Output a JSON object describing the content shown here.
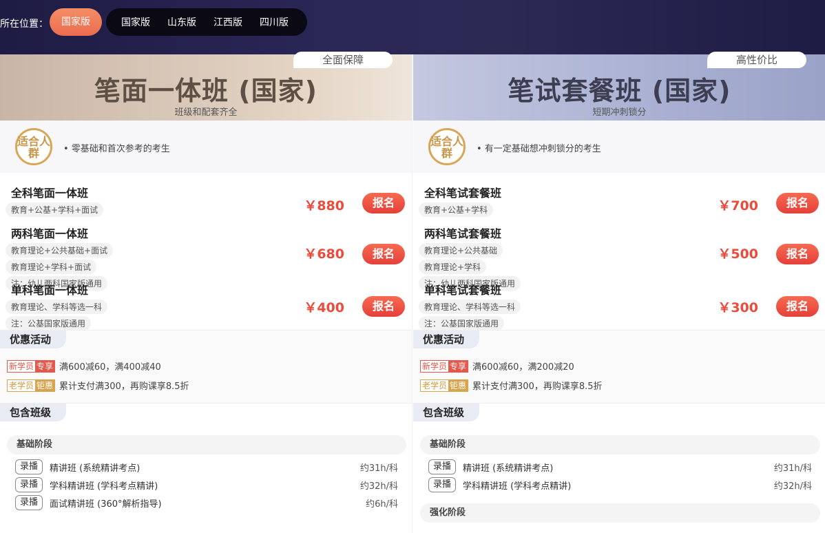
{
  "location": {
    "label": "所在位置：",
    "current": "国家版",
    "options": [
      "国家版",
      "山东版",
      "江西版",
      "四川版"
    ]
  },
  "colors": {
    "accent": "#ea6c4e",
    "price": "#ec4a3a",
    "gold": "#d9a657"
  },
  "columns": [
    {
      "tag": "全面保障",
      "title": "笔面一体班 (国家)",
      "subtitle": "班级和配套齐全",
      "badge": "适合人群",
      "target": "• 零基础和首次参考的考生",
      "products": [
        {
          "name": "全科笔面一体班",
          "chips": [
            "教育+公基+学科+面试"
          ],
          "price": "￥880",
          "button": "报名"
        },
        {
          "name": "两科笔面一体班",
          "chips": [
            "教育理论+公共基础+面试",
            "教育理论+学科+面试",
            "注：幼儿两科国家版通用"
          ],
          "price": "￥680",
          "button": "报名"
        },
        {
          "name": "单科笔面一体班",
          "chips": [
            "教育理论、学科等选一科",
            "注：公基国家版通用"
          ],
          "price": "￥400",
          "button": "报名"
        }
      ],
      "promo": {
        "heading": "优惠活动",
        "lines": [
          {
            "tag1": "新学员",
            "tag2": "专享",
            "text": "满600减60，满400减40"
          },
          {
            "tag1": "老学员",
            "tag2": "钜惠",
            "text": "累计支付满300，再购课享8.5折"
          }
        ]
      },
      "classes": {
        "heading": "包含班级",
        "stages": [
          {
            "name": "基础阶段",
            "courses": [
              {
                "type": "录播",
                "name": "精讲班 (系统精讲考点)",
                "hours": "约31h/科"
              },
              {
                "type": "录播",
                "name": "学科精讲班 (学科考点精讲)",
                "hours": "约32h/科"
              },
              {
                "type": "录播",
                "name": "面试精讲班 (360°解析指导)",
                "hours": "约6h/科"
              }
            ]
          }
        ]
      }
    },
    {
      "tag": "高性价比",
      "title": "笔试套餐班 (国家)",
      "subtitle": "短期冲刺锁分",
      "badge": "适合人群",
      "target": "• 有一定基础想冲刺锁分的考生",
      "products": [
        {
          "name": "全科笔试套餐班",
          "chips": [
            "教育+公基+学科"
          ],
          "price": "￥700",
          "button": "报名"
        },
        {
          "name": "两科笔试套餐班",
          "chips": [
            "教育理论+公共基础",
            "教育理论+学科",
            "注：幼儿两科国家版通用"
          ],
          "price": "￥500",
          "button": "报名"
        },
        {
          "name": "单科笔试套餐班",
          "chips": [
            "教育理论、学科等选一科",
            "注：公基国家版通用"
          ],
          "price": "￥300",
          "button": "报名"
        }
      ],
      "promo": {
        "heading": "优惠活动",
        "lines": [
          {
            "tag1": "新学员",
            "tag2": "专享",
            "text": "满600减60，满200减20"
          },
          {
            "tag1": "老学员",
            "tag2": "钜惠",
            "text": "累计支付满300，再购课享8.5折"
          }
        ]
      },
      "classes": {
        "heading": "包含班级",
        "stages": [
          {
            "name": "基础阶段",
            "courses": [
              {
                "type": "录播",
                "name": "精讲班 (系统精讲考点)",
                "hours": "约31h/科"
              },
              {
                "type": "录播",
                "name": "学科精讲班 (学科考点精讲)",
                "hours": "约32h/科"
              }
            ]
          },
          {
            "name": "强化阶段",
            "courses": []
          }
        ]
      }
    }
  ]
}
